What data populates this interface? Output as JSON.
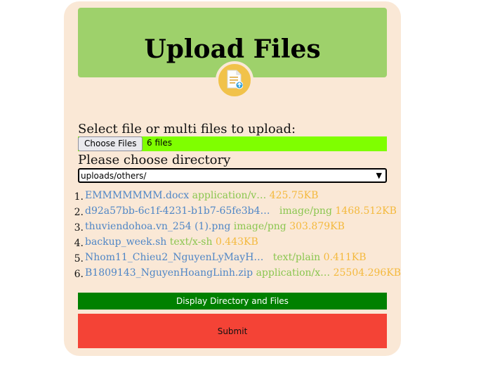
{
  "header": {
    "title": "Upload Files"
  },
  "upload": {
    "select_label": "Select file or multi files to upload:",
    "choose_button": "Choose Files",
    "file_count": "6 files"
  },
  "directory": {
    "label": "Please choose directory",
    "selected": "uploads/others/"
  },
  "files": [
    {
      "num": "1.",
      "name": "EMMMMMMM.docx",
      "type": "application/v…",
      "size": "425.75KB"
    },
    {
      "num": "2.",
      "name": "d92a57bb-6c1f-4231-b1b7-65fe3b4…",
      "type": "image/png",
      "size": "1468.512KB"
    },
    {
      "num": "3.",
      "name": "thuviendohoa.vn_254 (1).png",
      "type": "image/png",
      "size": "303.879KB"
    },
    {
      "num": "4.",
      "name": "backup_week.sh",
      "type": "text/x-sh",
      "size": "0.443KB"
    },
    {
      "num": "5.",
      "name": "Nhom11_Chieu2_NguyenLyMayH…",
      "type": "text/plain",
      "size": "0.411KB"
    },
    {
      "num": "6.",
      "name": "B1809143_NguyenHoangLinh.zip",
      "type": "application/x…",
      "size": "25504.296KB"
    }
  ],
  "actions": {
    "display_button": "Display Directory and Files",
    "submit_button": "Submit"
  },
  "colors": {
    "card_bg": "#fae8d6",
    "header_bg": "#9ed16b",
    "file_bar": "#7fff00",
    "display_button": "#008000",
    "submit_button": "#f44336",
    "file_name": "#4f86c6",
    "file_type": "#8ac64f",
    "file_size": "#f4b93d",
    "badge": "#f1c24a"
  },
  "icons": {
    "badge": "file-upload-icon",
    "dropdown": "chevron-down-icon"
  }
}
